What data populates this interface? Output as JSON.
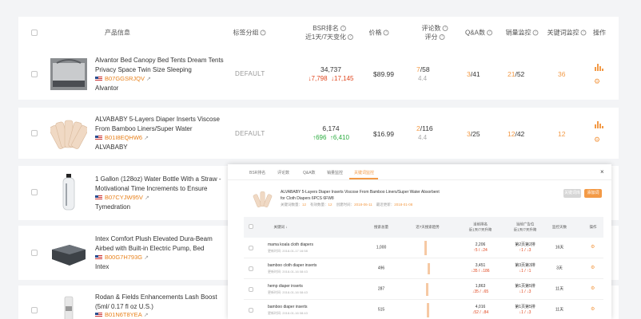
{
  "header": {
    "product": "产品信息",
    "tag": "标签分组",
    "bsr_line1": "BSR排名",
    "bsr_line2": "近1天/7天变化",
    "price": "价格",
    "review_line1": "评论数",
    "review_line2": "评分",
    "qa": "Q&A数",
    "sales": "销量监控",
    "keyword": "关键词监控",
    "ops": "操作"
  },
  "products": [
    {
      "title": "Alvantor Bed Canopy Bed Tents Dream Tents Privacy Space Twin Size Sleeping",
      "asin": "B07GGSRJQV",
      "brand": "Alvantor",
      "tag": "DEFAULT",
      "bsr": "34,737",
      "d1": "↓7,798",
      "d7": "↓17,145",
      "trend": "down",
      "price": "$89.99",
      "rev_a": "7",
      "rev_b": "/58",
      "rating": "4.4",
      "qa_a": "3",
      "qa_b": "/41",
      "sal_a": "21",
      "sal_b": "/52",
      "kw": "36"
    },
    {
      "title": "ALVABABY 5-Layers Diaper Inserts Viscose From Bamboo Liners/Super Water",
      "asin": "B01I8EQHW6",
      "brand": "ALVABABY",
      "tag": "DEFAULT",
      "bsr": "6,174",
      "d1": "↑696",
      "d7": "↑6,410",
      "trend": "up",
      "price": "$16.99",
      "rev_a": "2",
      "rev_b": "/116",
      "rating": "4.4",
      "qa_a": "3",
      "qa_b": "/25",
      "sal_a": "12",
      "sal_b": "/42",
      "kw": "12"
    },
    {
      "title": "1 Gallon (128oz) Water Bottle With a Straw - Motivational Time Increments to Ensure",
      "asin": "B07CYJW95V",
      "brand": "Tymedration"
    },
    {
      "title": "Intex Comfort Plush Elevated Dura-Beam Airbed with Built-in Electric Pump, Bed",
      "asin": "B00G7H793G",
      "brand": "Intex"
    },
    {
      "title": "Rodan & Fields Enhancements Lash Boost (5ml/ 0.17 fl oz U.S.)",
      "asin": "B01N6T8YEA",
      "brand": ""
    }
  ],
  "popup": {
    "tabs": [
      "BSR排名",
      "评论数",
      "Q&A数",
      "销量监控",
      "关键词监控"
    ],
    "close": "×",
    "title": "ALVABABY 5-Layers Diaper Inserts Viscose From Bamboo Liners/Super Water Absorbent for Cloth Diapers 6PCS 6FW8",
    "info_label1": "关键词数量：",
    "info_val1": "12",
    "info_label2": "有效数量：",
    "info_val2": "12",
    "info_label3": "创建时间：",
    "info_val3": "2018-06-11",
    "info_label4": "最近更新：",
    "info_val4": "2018-01-08",
    "btn_grey": "关键词库",
    "btn_orange": "添加词",
    "cols": [
      "关键词 ↓",
      "搜索总量",
      "近7天搜索趋势",
      "当前排名\n近1天/7天升降",
      "当前广告位\n近1天/7天升降",
      "监控天数",
      "操作"
    ],
    "rows": [
      {
        "kw": "mama koala cloth diapers",
        "date": "更新时间: 2018-01-17 16:58",
        "vol": "1,000",
        "rank": "2,206",
        "rank_d": "↑5 / ↓24",
        "ad": "第2页第2排",
        "ad_d": "↑1 / ↓3",
        "days": "16天"
      },
      {
        "kw": "bamboo cloth diaper inserts",
        "date": "更新时间: 2018-01-16 08:43",
        "vol": "496",
        "rank": "3,451",
        "rank_d": "↓35 / ↓186",
        "ad": "第3页第3排",
        "ad_d": "↓1 / ↑1",
        "days": "3天"
      },
      {
        "kw": "hemp diaper inserts",
        "date": "更新时间: 2018-01-16 08:43",
        "vol": "287",
        "rank": "1,863",
        "rank_d": "↓35 / ↓65",
        "ad": "第1页第5排",
        "ad_d": "↓1 / ↓3",
        "days": "11天"
      },
      {
        "kw": "bamboo diaper inserts",
        "date": "更新时间: 2018-01-16 08:43",
        "vol": "515",
        "rank": "4,016",
        "rank_d": "↓52 / ↓84",
        "ad": "第1页第5排",
        "ad_d": "↓1 / ↓3",
        "days": "11天"
      }
    ]
  },
  "colors": {
    "accent": "#f39a46",
    "red": "#e0461e",
    "green": "#2bac3f"
  },
  "icons": [
    "bar-chart-icon",
    "gear-icon",
    "external-link-icon",
    "us-flag-icon",
    "close-icon"
  ]
}
